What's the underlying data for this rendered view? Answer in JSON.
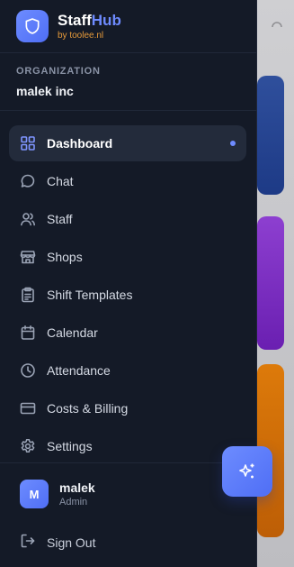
{
  "brand": {
    "name_main": "Staff",
    "name_accent": "Hub",
    "sub": "by toolee.nl"
  },
  "organization": {
    "label": "ORGANIZATION",
    "name": "malek inc"
  },
  "nav": {
    "items": [
      {
        "label": "Dashboard",
        "icon": "dashboard-icon",
        "active": true
      },
      {
        "label": "Chat",
        "icon": "chat-icon"
      },
      {
        "label": "Staff",
        "icon": "users-icon"
      },
      {
        "label": "Shops",
        "icon": "store-icon"
      },
      {
        "label": "Shift Templates",
        "icon": "clipboard-icon"
      },
      {
        "label": "Calendar",
        "icon": "calendar-icon"
      },
      {
        "label": "Attendance",
        "icon": "clock-icon"
      },
      {
        "label": "Costs & Billing",
        "icon": "credit-card-icon"
      },
      {
        "label": "Settings",
        "icon": "gear-icon"
      }
    ]
  },
  "user": {
    "initial": "M",
    "name": "malek",
    "role": "Admin"
  },
  "signout": {
    "label": "Sign Out"
  },
  "colors": {
    "drawer_bg": "#141a27",
    "accent": "#6e8bff",
    "brand_sub": "#e69a3a"
  }
}
